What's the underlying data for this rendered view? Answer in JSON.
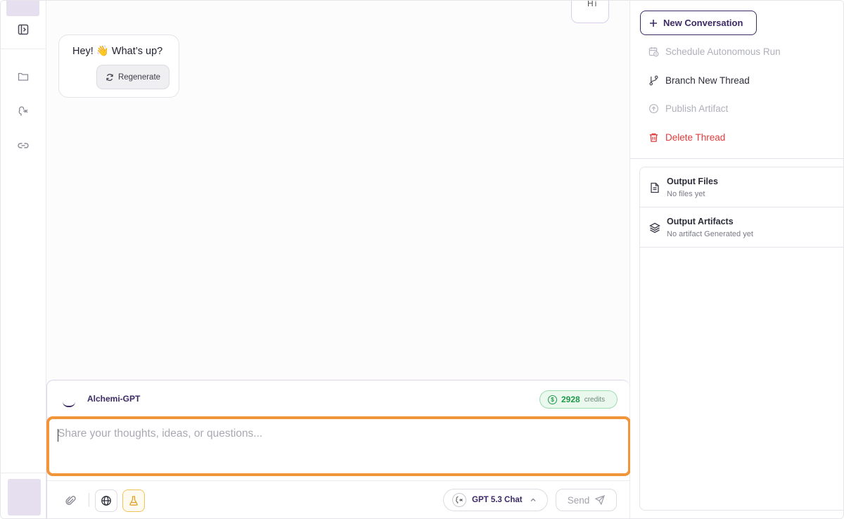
{
  "chat": {
    "user_message_partial": "Hi",
    "assistant_message": "Hey! 👋 What’s up?",
    "regenerate_label": "Regenerate"
  },
  "composer": {
    "model_name": "Alchemi-GPT",
    "credits_value": "2928",
    "credits_label": "credits",
    "input_placeholder": "Share your thoughts, ideas, or questions...",
    "input_value": "",
    "model_picker_label": "GPT 5.3 Chat",
    "send_label": "Send"
  },
  "actions": {
    "new_conversation": "New Conversation",
    "schedule_run": "Schedule Autonomous Run",
    "branch_thread": "Branch New Thread",
    "publish_artifact": "Publish Artifact",
    "delete_thread": "Delete Thread"
  },
  "outputs": {
    "files_title": "Output Files",
    "files_sub": "No files yet",
    "artifacts_title": "Output Artifacts",
    "artifacts_sub": "No artifact Generated yet"
  },
  "colors": {
    "brand": "#3b2a63",
    "highlight": "#f0953a",
    "credits_green": "#1f9a4a",
    "danger": "#e23b3b"
  },
  "icons": {
    "rail": [
      "sidebar-toggle-icon",
      "folder-icon",
      "brain-icon",
      "link-icon"
    ],
    "composer": [
      "paperclip-icon",
      "globe-icon",
      "flask-icon",
      "send-icon",
      "chevron-up-icon"
    ],
    "actions": [
      "plus-icon",
      "calendar-clock-icon",
      "git-branch-icon",
      "upload-circle-icon",
      "trash-icon"
    ],
    "outputs": [
      "file-text-icon",
      "layers-icon"
    ]
  }
}
